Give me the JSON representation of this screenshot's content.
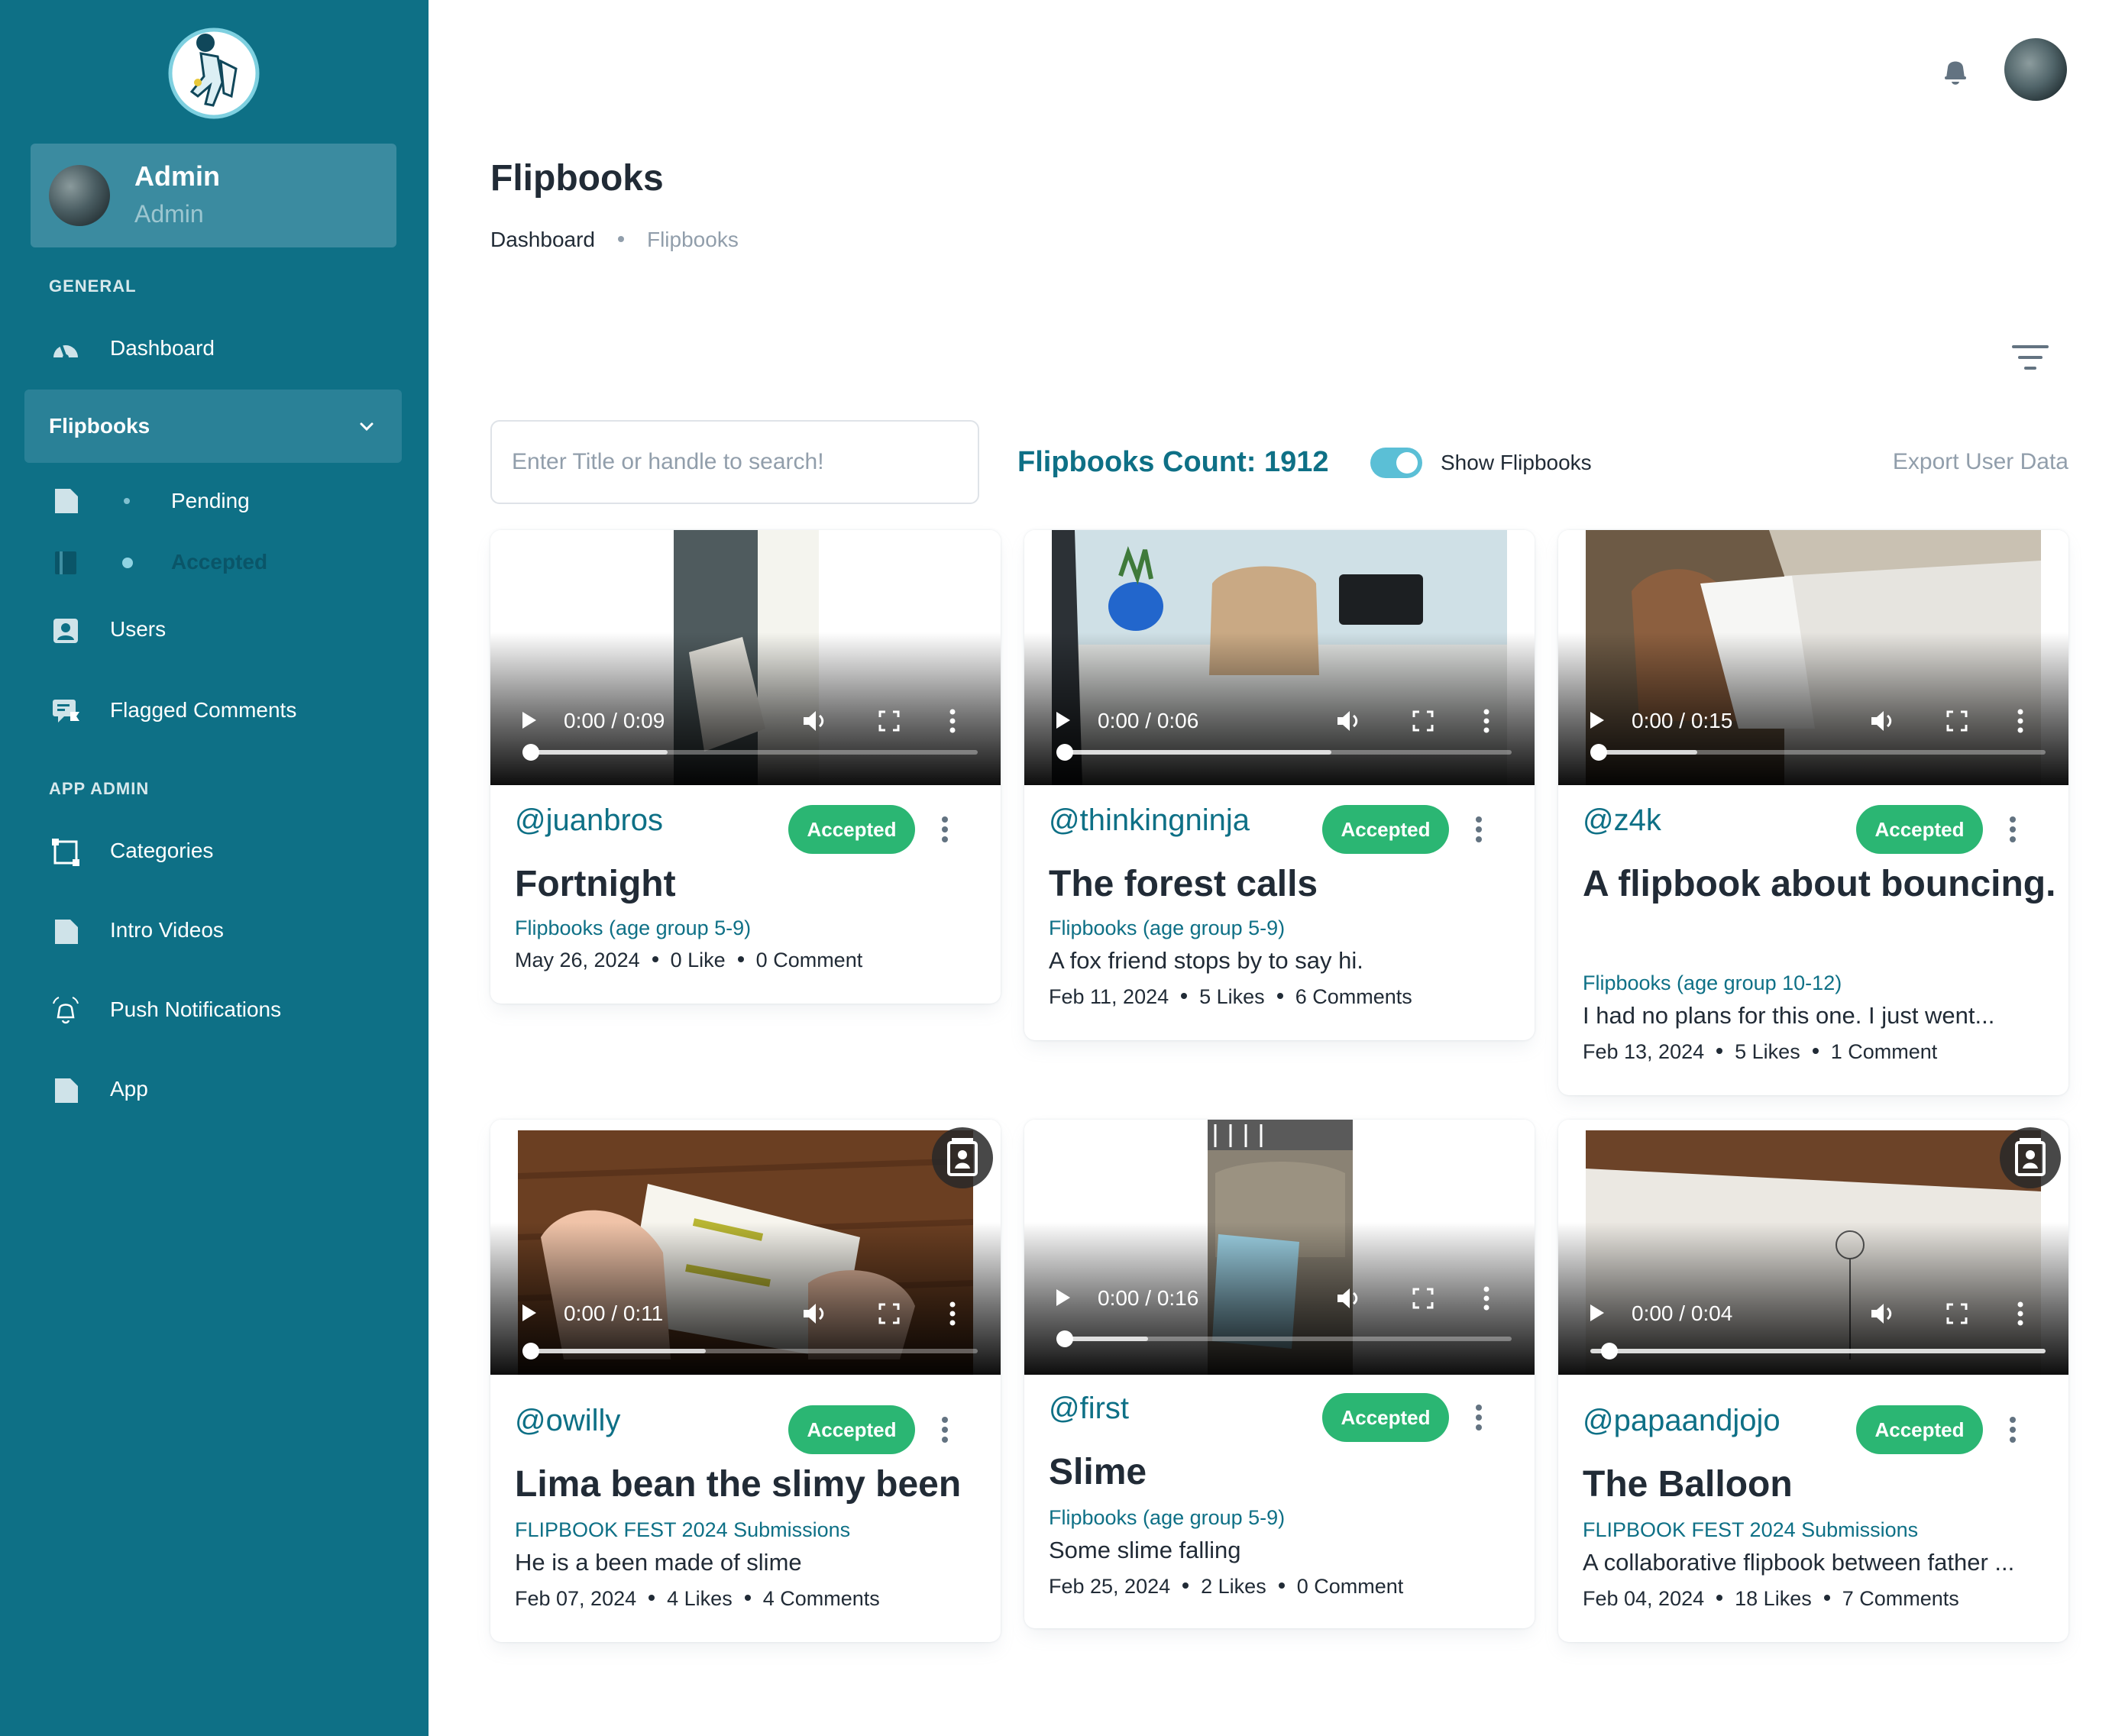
{
  "sidebar": {
    "account": {
      "name": "Admin",
      "role": "Admin"
    },
    "sections": {
      "general": "GENERAL",
      "app_admin": "APP ADMIN"
    },
    "items": {
      "dashboard": "Dashboard",
      "flipbooks": "Flipbooks",
      "pending": "Pending",
      "accepted": "Accepted",
      "users": "Users",
      "flagged_comments": "Flagged Comments",
      "categories": "Categories",
      "intro_videos": "Intro Videos",
      "push_notifications": "Push Notifications",
      "app": "App"
    }
  },
  "header": {
    "title": "Flipbooks",
    "breadcrumb": [
      "Dashboard",
      "Flipbooks"
    ]
  },
  "toolbar": {
    "search_placeholder": "Enter Title or handle to search!",
    "count_label": "Flipbooks Count: 1912",
    "toggle_label": "Show Flipbooks",
    "toggle_on": true,
    "export_label": "Export User Data"
  },
  "colors": {
    "sidebar": "#0e7086",
    "accent": "#0e7086",
    "accepted": "#2bb673",
    "toggle": "#5bbfd6"
  },
  "cards": [
    {
      "handle": "@juanbros",
      "status": "Accepted",
      "title": "Fortnight",
      "category": "Flipbooks (age group 5-9)",
      "desc": "",
      "date": "May 26, 2024",
      "likes": "0 Like",
      "comments": "0 Comment",
      "time": "0:00 / 0:09"
    },
    {
      "handle": "@thinkingninja",
      "status": "Accepted",
      "title": "The forest calls",
      "category": "Flipbooks (age group 5-9)",
      "desc": "A fox friend stops by to say hi.",
      "date": "Feb 11, 2024",
      "likes": "5 Likes",
      "comments": "6 Comments",
      "time": "0:00 / 0:06"
    },
    {
      "handle": "@z4k",
      "status": "Accepted",
      "title": "A flipbook about bouncing.",
      "category": "Flipbooks (age group 10-12)",
      "desc": "I had no plans for this one. I just went...",
      "date": "Feb 13, 2024",
      "likes": "5 Likes",
      "comments": "1 Comment",
      "time": "0:00 / 0:15"
    },
    {
      "handle": "@owilly",
      "status": "Accepted",
      "title": "Lima bean the slimy been",
      "category": "FLIPBOOK FEST 2024 Submissions",
      "desc": "He is a been made of slime",
      "date": "Feb 07, 2024",
      "likes": "4 Likes",
      "comments": "4 Comments",
      "time": "0:00 / 0:11"
    },
    {
      "handle": "@first",
      "status": "Accepted",
      "title": "Slime",
      "category": "Flipbooks (age group 5-9)",
      "desc": "Some slime falling",
      "date": "Feb 25, 2024",
      "likes": "2 Likes",
      "comments": "0 Comment",
      "time": "0:00 / 0:16"
    },
    {
      "handle": "@papaandjojo",
      "status": "Accepted",
      "title": "The Balloon",
      "category": "FLIPBOOK FEST 2024 Submissions",
      "desc": "A collaborative flipbook between father ...",
      "date": "Feb 04, 2024",
      "likes": "18 Likes",
      "comments": "7 Comments",
      "time": "0:00 / 0:04"
    }
  ]
}
